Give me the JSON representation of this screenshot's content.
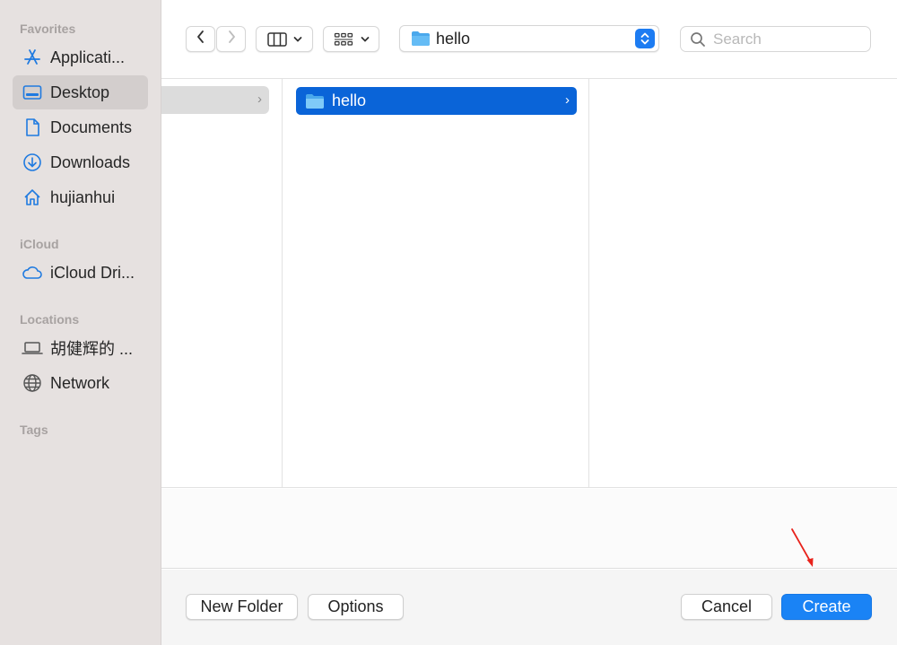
{
  "sidebar": {
    "sections": [
      {
        "title": "Favorites"
      },
      {
        "title": "iCloud"
      },
      {
        "title": "Locations"
      },
      {
        "title": "Tags"
      }
    ],
    "items": [
      {
        "label": "Applicati...",
        "icon": "applications-icon",
        "selected": false
      },
      {
        "label": "Desktop",
        "icon": "desktop-icon",
        "selected": true
      },
      {
        "label": "Documents",
        "icon": "document-icon",
        "selected": false
      },
      {
        "label": "Downloads",
        "icon": "downloads-icon",
        "selected": false
      },
      {
        "label": "hujianhui",
        "icon": "home-icon",
        "selected": false
      },
      {
        "label": "iCloud Dri...",
        "icon": "cloud-icon",
        "selected": false
      },
      {
        "label": "胡健辉的 ...",
        "icon": "laptop-icon",
        "selected": false
      },
      {
        "label": "Network",
        "icon": "globe-icon",
        "selected": false
      }
    ]
  },
  "toolbar": {
    "back_icon": "chevron-left-icon",
    "forward_icon": "chevron-right-icon",
    "view_mode_icon": "columns-view-icon",
    "group_icon": "grid-group-icon",
    "path": {
      "label": "hello",
      "icon": "folder-icon"
    },
    "search": {
      "placeholder": "Search",
      "value": ""
    }
  },
  "browser": {
    "column1": [
      {
        "label": "hello",
        "icon": "folder-icon",
        "selected": true
      }
    ]
  },
  "buttons": {
    "new_folder": "New Folder",
    "options": "Options",
    "cancel": "Cancel",
    "create": "Create"
  },
  "colors": {
    "accent": "#1a83f5",
    "selection": "#0a64d8",
    "sidebar_bg": "#e6e1e0",
    "annotation": "#e8221b"
  }
}
